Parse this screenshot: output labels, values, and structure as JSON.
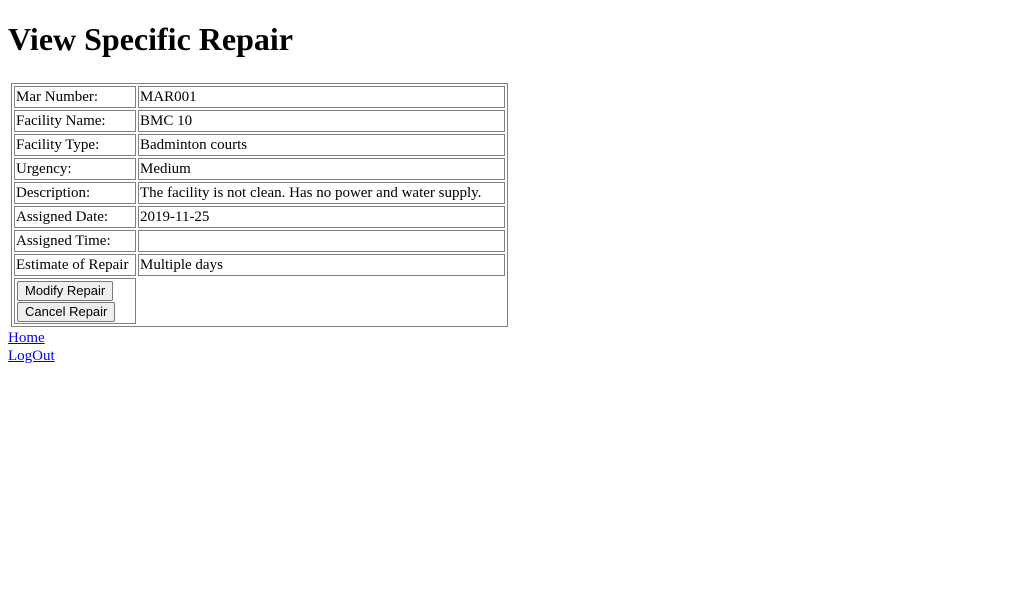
{
  "page": {
    "title": "View Specific Repair"
  },
  "details": [
    {
      "label": "Mar Number:",
      "value": "MAR001"
    },
    {
      "label": "Facility Name:",
      "value": "BMC 10"
    },
    {
      "label": "Facility Type:",
      "value": "Badminton courts"
    },
    {
      "label": "Urgency:",
      "value": "Medium"
    },
    {
      "label": "Description:",
      "value": "The facility is not clean. Has no power and water supply."
    },
    {
      "label": "Assigned Date:",
      "value": "2019-11-25"
    },
    {
      "label": "Assigned Time:",
      "value": ""
    },
    {
      "label": "Estimate of Repair",
      "value": "Multiple days"
    }
  ],
  "actions": {
    "modify_label": "Modify Repair",
    "cancel_label": "Cancel Repair"
  },
  "links": {
    "home": "Home",
    "logout": "LogOut"
  }
}
